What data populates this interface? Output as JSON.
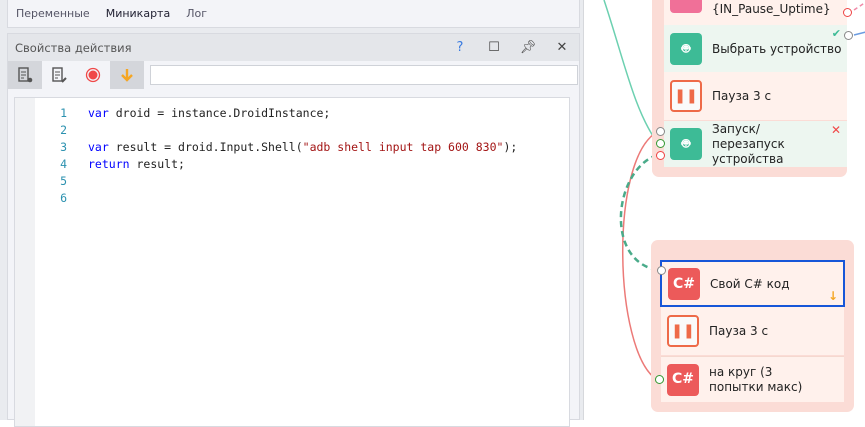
{
  "tabs": [
    "Переменные",
    "Миникарта",
    "Лог"
  ],
  "panel": {
    "title": "Свойства действия",
    "help": "?"
  },
  "code": [
    {
      "n": "1",
      "parts": [
        [
          "kw",
          "var"
        ],
        [
          "",
          "droid = instance.DroidInstance;"
        ]
      ]
    },
    {
      "n": "2",
      "parts": []
    },
    {
      "n": "3",
      "parts": [
        [
          "kw",
          "var"
        ],
        [
          "",
          "result = droid.Input.Shell("
        ],
        [
          "str",
          "\"adb shell input tap 600 830\""
        ],
        [
          "",
          ");"
        ]
      ]
    },
    {
      "n": "4",
      "parts": [
        [
          "kw",
          "return"
        ],
        [
          "",
          "result;"
        ]
      ]
    },
    {
      "n": "5",
      "parts": []
    },
    {
      "n": "6",
      "parts": []
    }
  ],
  "nodes": {
    "pause_uptime": "{IN_Pause_Uptime}",
    "select_device": "Выбрать устройство",
    "pause1": "Пауза 3 с",
    "restart": "Запуск/перезапуск устройства",
    "custom_cs": "Свой C# код",
    "pause2": "Пауза 3 с",
    "loop": "на круг (3 попытки макс)",
    "cs_label": "C#"
  }
}
